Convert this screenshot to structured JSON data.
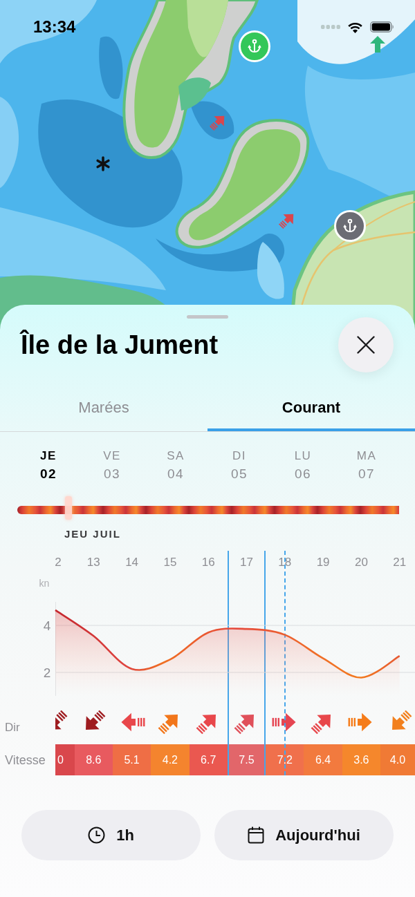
{
  "status_bar": {
    "time": "13:34"
  },
  "map": {
    "markers": [
      {
        "kind": "anchor",
        "color": "#34c759"
      },
      {
        "kind": "anchor",
        "color": "#6b6c74"
      }
    ]
  },
  "sheet": {
    "title": "Île de la Jument"
  },
  "tabs": [
    {
      "label": "Marées",
      "selected": false
    },
    {
      "label": "Courant",
      "selected": true
    }
  ],
  "days": [
    {
      "weekday": "JE",
      "day": "02",
      "selected": true
    },
    {
      "weekday": "VE",
      "day": "03",
      "selected": false
    },
    {
      "weekday": "SA",
      "day": "04",
      "selected": false
    },
    {
      "weekday": "DI",
      "day": "05",
      "selected": false
    },
    {
      "weekday": "LU",
      "day": "06",
      "selected": false
    },
    {
      "weekday": "MA",
      "day": "07",
      "selected": false
    }
  ],
  "timeline": {
    "level": 0.134,
    "label": "JEU JUIL"
  },
  "chart": {
    "chart_data": {
      "type": "area",
      "ylabel": "kn",
      "categories": [
        "2",
        "13",
        "14",
        "15",
        "16",
        "17",
        "18",
        "19",
        "20",
        "21"
      ],
      "values": [
        4.65,
        3.55,
        2.15,
        2.55,
        3.7,
        3.85,
        3.6,
        2.6,
        1.78,
        2.7
      ],
      "ylim": [
        1,
        5
      ],
      "yticks": [
        2,
        4
      ]
    }
  },
  "direction_row": {
    "label": "Dir",
    "items": [
      {
        "kind": "southwest",
        "color": "#9e1c20"
      },
      {
        "kind": "southwest",
        "color": "#9e1c20"
      },
      {
        "kind": "west",
        "color": "#e8474b"
      },
      {
        "kind": "northeast",
        "color": "#f2761a"
      },
      {
        "kind": "northeast",
        "color": "#e8474b"
      },
      {
        "kind": "northeast",
        "color": "#e0505a"
      },
      {
        "kind": "east",
        "color": "#e54552"
      },
      {
        "kind": "northeast",
        "color": "#e8474b"
      },
      {
        "kind": "east",
        "color": "#f57c1a"
      },
      {
        "kind": "southwest",
        "color": "#f2801e"
      }
    ]
  },
  "speed_row": {
    "label": "Vitesse",
    "items": [
      {
        "value": "0",
        "color": "#d9474c",
        "selected": false,
        "current": false
      },
      {
        "value": "8.6",
        "color": "#e85a5f",
        "selected": false,
        "current": false
      },
      {
        "value": "5.1",
        "color": "#ef6e45",
        "selected": false,
        "current": false
      },
      {
        "value": "4.2",
        "color": "#f4842e",
        "selected": false,
        "current": false
      },
      {
        "value": "6.7",
        "color": "#ea5850",
        "selected": false,
        "current": false
      },
      {
        "value": "7.5",
        "color": "#e2666a",
        "selected": true,
        "current": false
      },
      {
        "value": "7.2",
        "color": "#f0704c",
        "selected": false,
        "current": true
      },
      {
        "value": "6.4",
        "color": "#f27a3e",
        "selected": false,
        "current": false
      },
      {
        "value": "3.6",
        "color": "#f5872c",
        "selected": false,
        "current": false
      },
      {
        "value": "4.0",
        "color": "#f07a35",
        "selected": false,
        "current": false
      }
    ]
  },
  "buttons": [
    {
      "kind": "interval",
      "label": "1h"
    },
    {
      "kind": "date",
      "label": "Aujourd'hui"
    }
  ]
}
